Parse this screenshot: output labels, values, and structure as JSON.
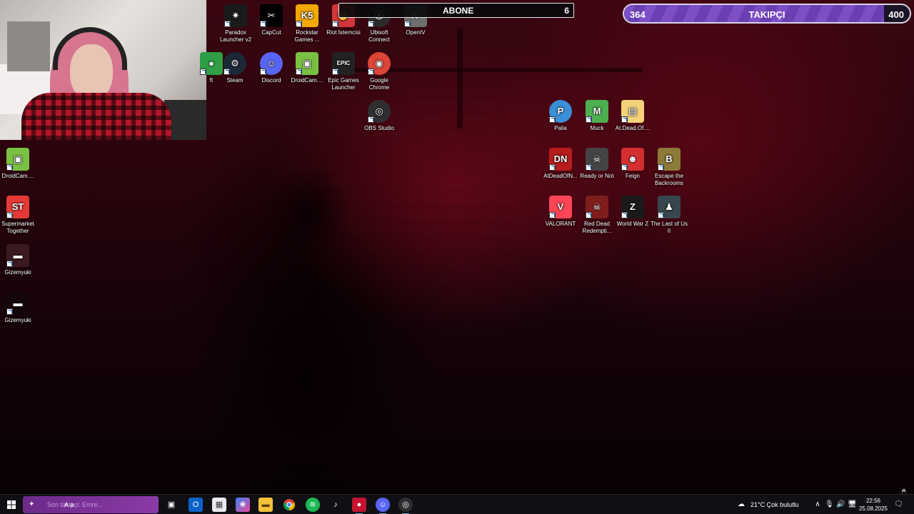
{
  "overlay": {
    "abone": {
      "label": "ABONE",
      "count": "6"
    },
    "takipci": {
      "current": "364",
      "label": "TAKIPÇI",
      "goal": "400",
      "progress": 0.91,
      "accent": "#7c4fc6"
    }
  },
  "desktop": {
    "icons": [
      {
        "key": "paradox",
        "label": "Paradox Launcher v2",
        "icon": "paradox-icon",
        "color": "#1b1b1b"
      },
      {
        "key": "capcut",
        "label": "CapCut",
        "icon": "capcut-icon",
        "color": "#000000"
      },
      {
        "key": "rockstar",
        "label": "Rockstar Games ...",
        "icon": "rockstar-icon",
        "color": "#f2a900"
      },
      {
        "key": "riot",
        "label": "Riot İstemcisi",
        "icon": "riot-icon",
        "color": "#d13639"
      },
      {
        "key": "ubisoft",
        "label": "Ubisoft Connect",
        "icon": "ubisoft-icon",
        "color": "#2b2b2b"
      },
      {
        "key": "openiv",
        "label": "OpenIV",
        "icon": "openiv-icon",
        "color": "#6d6d6d"
      },
      {
        "key": "left-cut-1",
        "label": "ft",
        "icon": "app-icon",
        "color": "#2f9e44"
      },
      {
        "key": "steam",
        "label": "Steam",
        "icon": "steam-icon",
        "color": "#1b2838"
      },
      {
        "key": "discord",
        "label": "Discord",
        "icon": "discord-icon",
        "color": "#5865f2"
      },
      {
        "key": "droidcam-top",
        "label": "DroidCam....",
        "icon": "droidcam-icon",
        "color": "#7ac143"
      },
      {
        "key": "epic",
        "label": "Epic Games Launcher",
        "icon": "epic-games-icon",
        "color": "#222222"
      },
      {
        "key": "chrome",
        "label": "Google Chrome",
        "icon": "chrome-icon",
        "color": "#db4437"
      },
      {
        "key": "obs",
        "label": "OBS Studio",
        "icon": "obs-icon",
        "color": "#302e31"
      },
      {
        "key": "droidcam-left",
        "label": "DroidCam....",
        "icon": "droidcam-icon",
        "color": "#7ac143"
      },
      {
        "key": "supermarket",
        "label": "Supermarket Together",
        "icon": "supermarket-together-icon",
        "color": "#e53935"
      },
      {
        "key": "gizemyuki-1",
        "label": "Gizemyuki",
        "icon": "video-shortcut-icon",
        "color": "#3a1a20"
      },
      {
        "key": "gizemyuki-2",
        "label": "Gizemyuki",
        "icon": "video-shortcut-icon",
        "color": "#140508"
      },
      {
        "key": "palia",
        "label": "Palia",
        "icon": "palia-icon",
        "color": "#3a8fd6"
      },
      {
        "key": "muck",
        "label": "Muck",
        "icon": "muck-icon",
        "color": "#4caf50"
      },
      {
        "key": "atdeadof-folder",
        "label": "At.Dead.Of....",
        "icon": "folder-icon",
        "color": "#f4d27a"
      },
      {
        "key": "atdeadofn",
        "label": "AtDeadOfN...",
        "icon": "at-dead-of-night-icon",
        "color": "#b71c1c"
      },
      {
        "key": "readyornot",
        "label": "Ready or Not",
        "icon": "ready-or-not-icon",
        "color": "#444444"
      },
      {
        "key": "feign",
        "label": "Feign",
        "icon": "feign-icon",
        "color": "#d32f2f"
      },
      {
        "key": "escape",
        "label": "Escape the Backrooms",
        "icon": "escape-backrooms-icon",
        "color": "#8d7b3a"
      },
      {
        "key": "valorant",
        "label": "VALORANT",
        "icon": "valorant-icon",
        "color": "#fd4556"
      },
      {
        "key": "rdr",
        "label": "Red Dead Redempti...",
        "icon": "red-dead-icon",
        "color": "#7f1d1d"
      },
      {
        "key": "wwz",
        "label": "World War Z",
        "icon": "world-war-z-icon",
        "color": "#1a1a1a"
      },
      {
        "key": "tlou",
        "label": "The Last of Us II",
        "icon": "last-of-us-icon",
        "color": "#37474f"
      }
    ]
  },
  "taskbar": {
    "chat_text": "Son takipçi: Emre...",
    "search_hint": "A a",
    "weather": "21°C  Çok bulutlu",
    "time": "22:56",
    "date": "25.08.2025"
  }
}
